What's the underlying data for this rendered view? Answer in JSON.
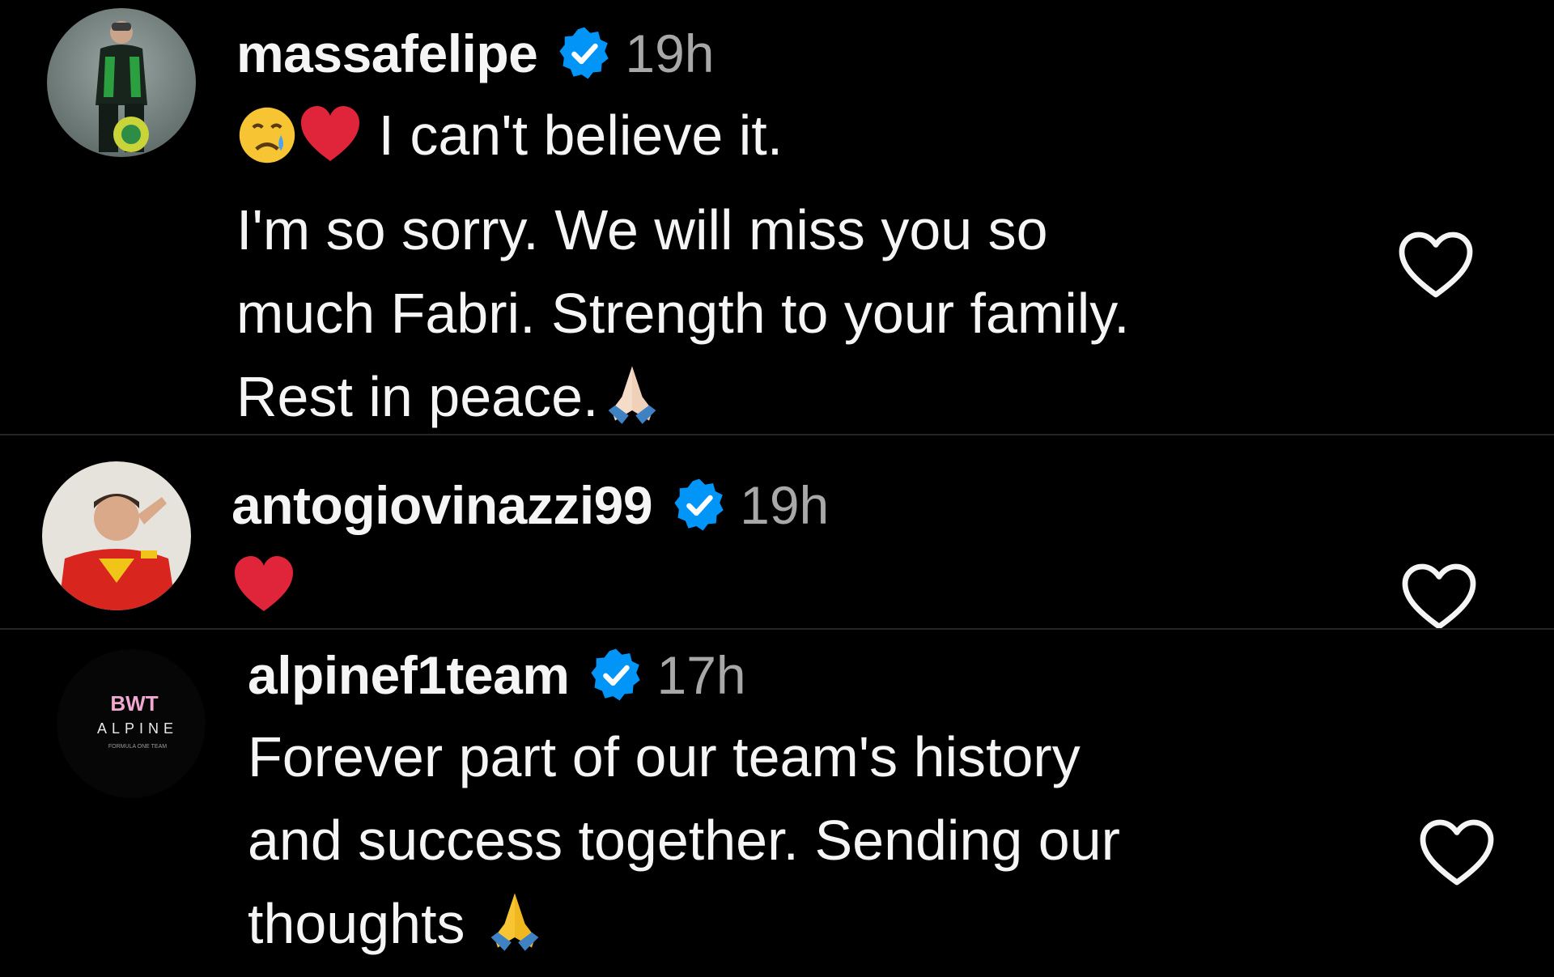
{
  "comments": [
    {
      "username": "massafelipe",
      "time": "19h",
      "lines": [
        "I can't believe it.",
        "I'm so sorry. We will miss you so",
        "much Fabri. Strength to your family.",
        "Rest in peace."
      ],
      "leading_emojis": [
        "crying-face-emoji",
        "red-heart-emoji"
      ],
      "trailing_emoji": "folded-hands-emoji"
    },
    {
      "username": "antogiovinazzi99",
      "time": "19h",
      "lines": [
        ""
      ],
      "leading_emojis": [
        "red-heart-emoji"
      ]
    },
    {
      "username": "alpinef1team",
      "time": "17h",
      "lines": [
        "Forever part of our team's history",
        "and success together. Sending our",
        "thoughts "
      ],
      "trailing_emoji": "folded-hands-emoji",
      "avatar_logo": {
        "line1": "BWT",
        "line2": "ALPINE",
        "line3": "FORMULA ONE TEAM"
      }
    }
  ],
  "colors": {
    "background": "#000000",
    "text": "#f5f5f5",
    "muted": "#a8a8a8",
    "verified": "#0095f6",
    "heart": "#e0245e",
    "divider": "#262626"
  },
  "icons": {
    "verified": "verified-badge-icon",
    "like": "heart-outline-icon"
  }
}
